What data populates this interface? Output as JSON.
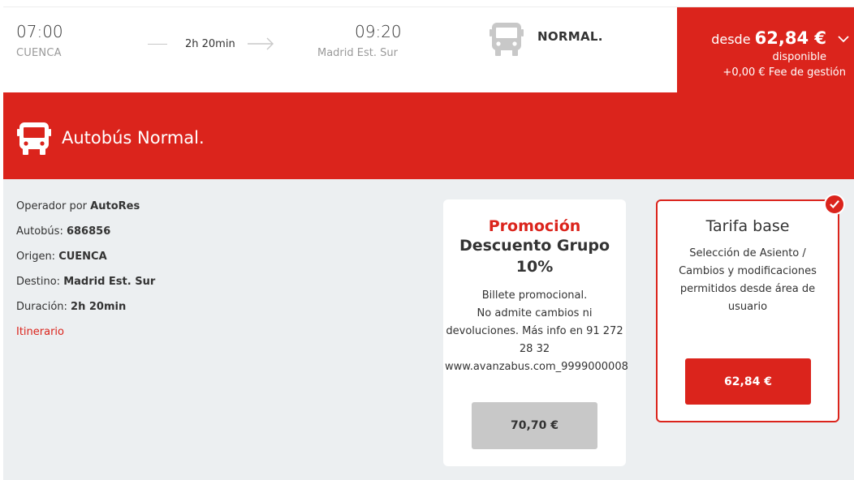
{
  "trip": {
    "departure_time": "07:00",
    "departure_city": "CUENCA",
    "duration": "2h 20min",
    "arrival_time": "09:20",
    "arrival_city": "Madrid Est. Sur",
    "bus_class": "NORMAL.",
    "price_prefix": "desde",
    "price": "62,84 €",
    "availability": "disponible",
    "fee": "+0,00 € Fee de gestión",
    "icons": [
      "bus-icon",
      "arrow-right-icon",
      "chevron-down-icon"
    ]
  },
  "banner": {
    "title": "Autobús Normal.",
    "icon": "bus-icon"
  },
  "details": {
    "operator_label": "Operador por ",
    "operator_value": "AutoRes",
    "bus_label": "Autobús: ",
    "bus_value": "686856",
    "origin_label": "Origen: ",
    "origin_value": "CUENCA",
    "destination_label": "Destino: ",
    "destination_value": "Madrid Est. Sur",
    "duration_label": "Duración: ",
    "duration_value": "2h 20min",
    "itinerary_link": "Itinerario"
  },
  "fares": {
    "promo": {
      "title": "Promoción",
      "subtitle": "Descuento Grupo 10%",
      "description": "Billete promocional.\nNo admite cambios ni devoluciones. Más info en 91 272 28 32 www.avanzabus.com_9999000008",
      "price": "70,70 €"
    },
    "base": {
      "title": "Tarifa base",
      "description": "Selección de Asiento / Cambios y modificaciones permitidos desde área de usuario",
      "price": "62,84 €",
      "selected_icon": "checkmark-icon"
    }
  },
  "colors": {
    "brand_red": "#db241c",
    "background_grey": "#eceff1",
    "button_grey": "#c8c8c8"
  }
}
